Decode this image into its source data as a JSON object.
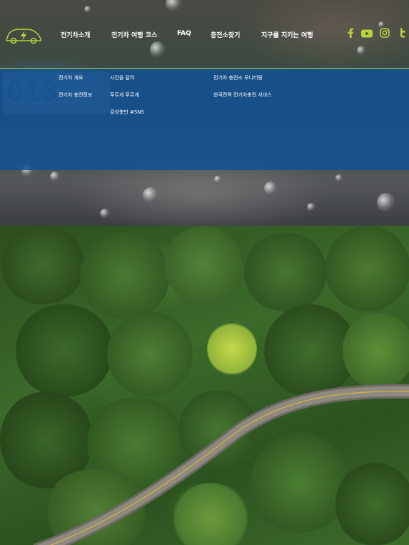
{
  "hero": {
    "plate_text": "613"
  },
  "nav": {
    "items": [
      "전기차소개",
      "전기차 여행 코스",
      "FAQ",
      "충전소찾기",
      "지구를 지키는 여행"
    ]
  },
  "social": [
    "facebook-icon",
    "youtube-icon",
    "instagram-icon",
    "twitter-icon"
  ],
  "dropdown": {
    "col1": [
      "전기차 개요",
      "전기차 충전정보"
    ],
    "col2": [
      "시간을 달려",
      "푸르게 푸르게",
      "감성충만 #SNS"
    ],
    "col3": [
      "전기차 충전소 모니터링",
      "한국전력 전기차충전 서비스"
    ]
  },
  "colors": {
    "accent": "#b6d63a",
    "dropdown_bg": "#115294",
    "text": "#ffffff"
  }
}
